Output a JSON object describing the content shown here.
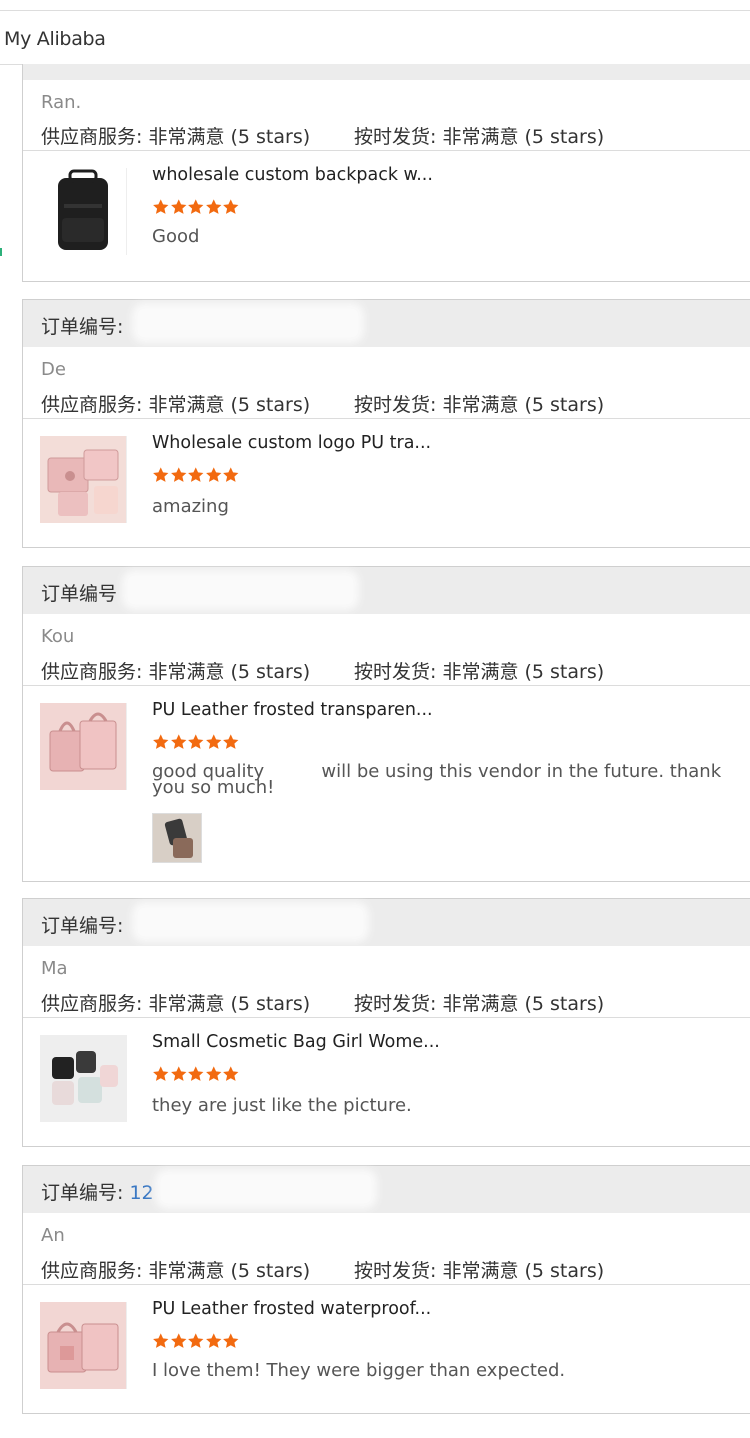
{
  "header": {
    "title": "My Alibaba"
  },
  "rating_label_supplier": "供应商服务: 非常满意 (5 stars)",
  "rating_label_ontime": "按时发货: 非常满意 (5 stars)",
  "reviews": [
    {
      "order_label": "",
      "order_num": "",
      "buyer": "Ran.",
      "product_title": "wholesale custom backpack w...",
      "stars": 5,
      "comment": "Good",
      "comment2": ""
    },
    {
      "order_label": "订单编号:",
      "order_num": "",
      "buyer": "De",
      "product_title": "Wholesale custom logo PU tra...",
      "stars": 5,
      "comment": "amazing",
      "comment2": ""
    },
    {
      "order_label": "订单编号",
      "order_num": "",
      "buyer": "Kou",
      "product_title": "PU Leather frosted transparen...",
      "stars": 5,
      "comment": "good quality          will be using this vendor in the future. thank",
      "comment2": "you so much!"
    },
    {
      "order_label": "订单编号:",
      "order_num": "",
      "buyer": "Ma",
      "product_title": "Small Cosmetic Bag Girl Wome...",
      "stars": 5,
      "comment": "they are just like the picture.",
      "comment2": ""
    },
    {
      "order_label": "订单编号:",
      "order_num": "12",
      "buyer": "An",
      "product_title": "PU Leather frosted waterproof...",
      "stars": 5,
      "comment": "I love them! They were bigger than expected.",
      "comment2": ""
    }
  ],
  "colors": {
    "star": "#f26a10",
    "order_link": "#3a78c3",
    "header_bg": "#ececec"
  }
}
